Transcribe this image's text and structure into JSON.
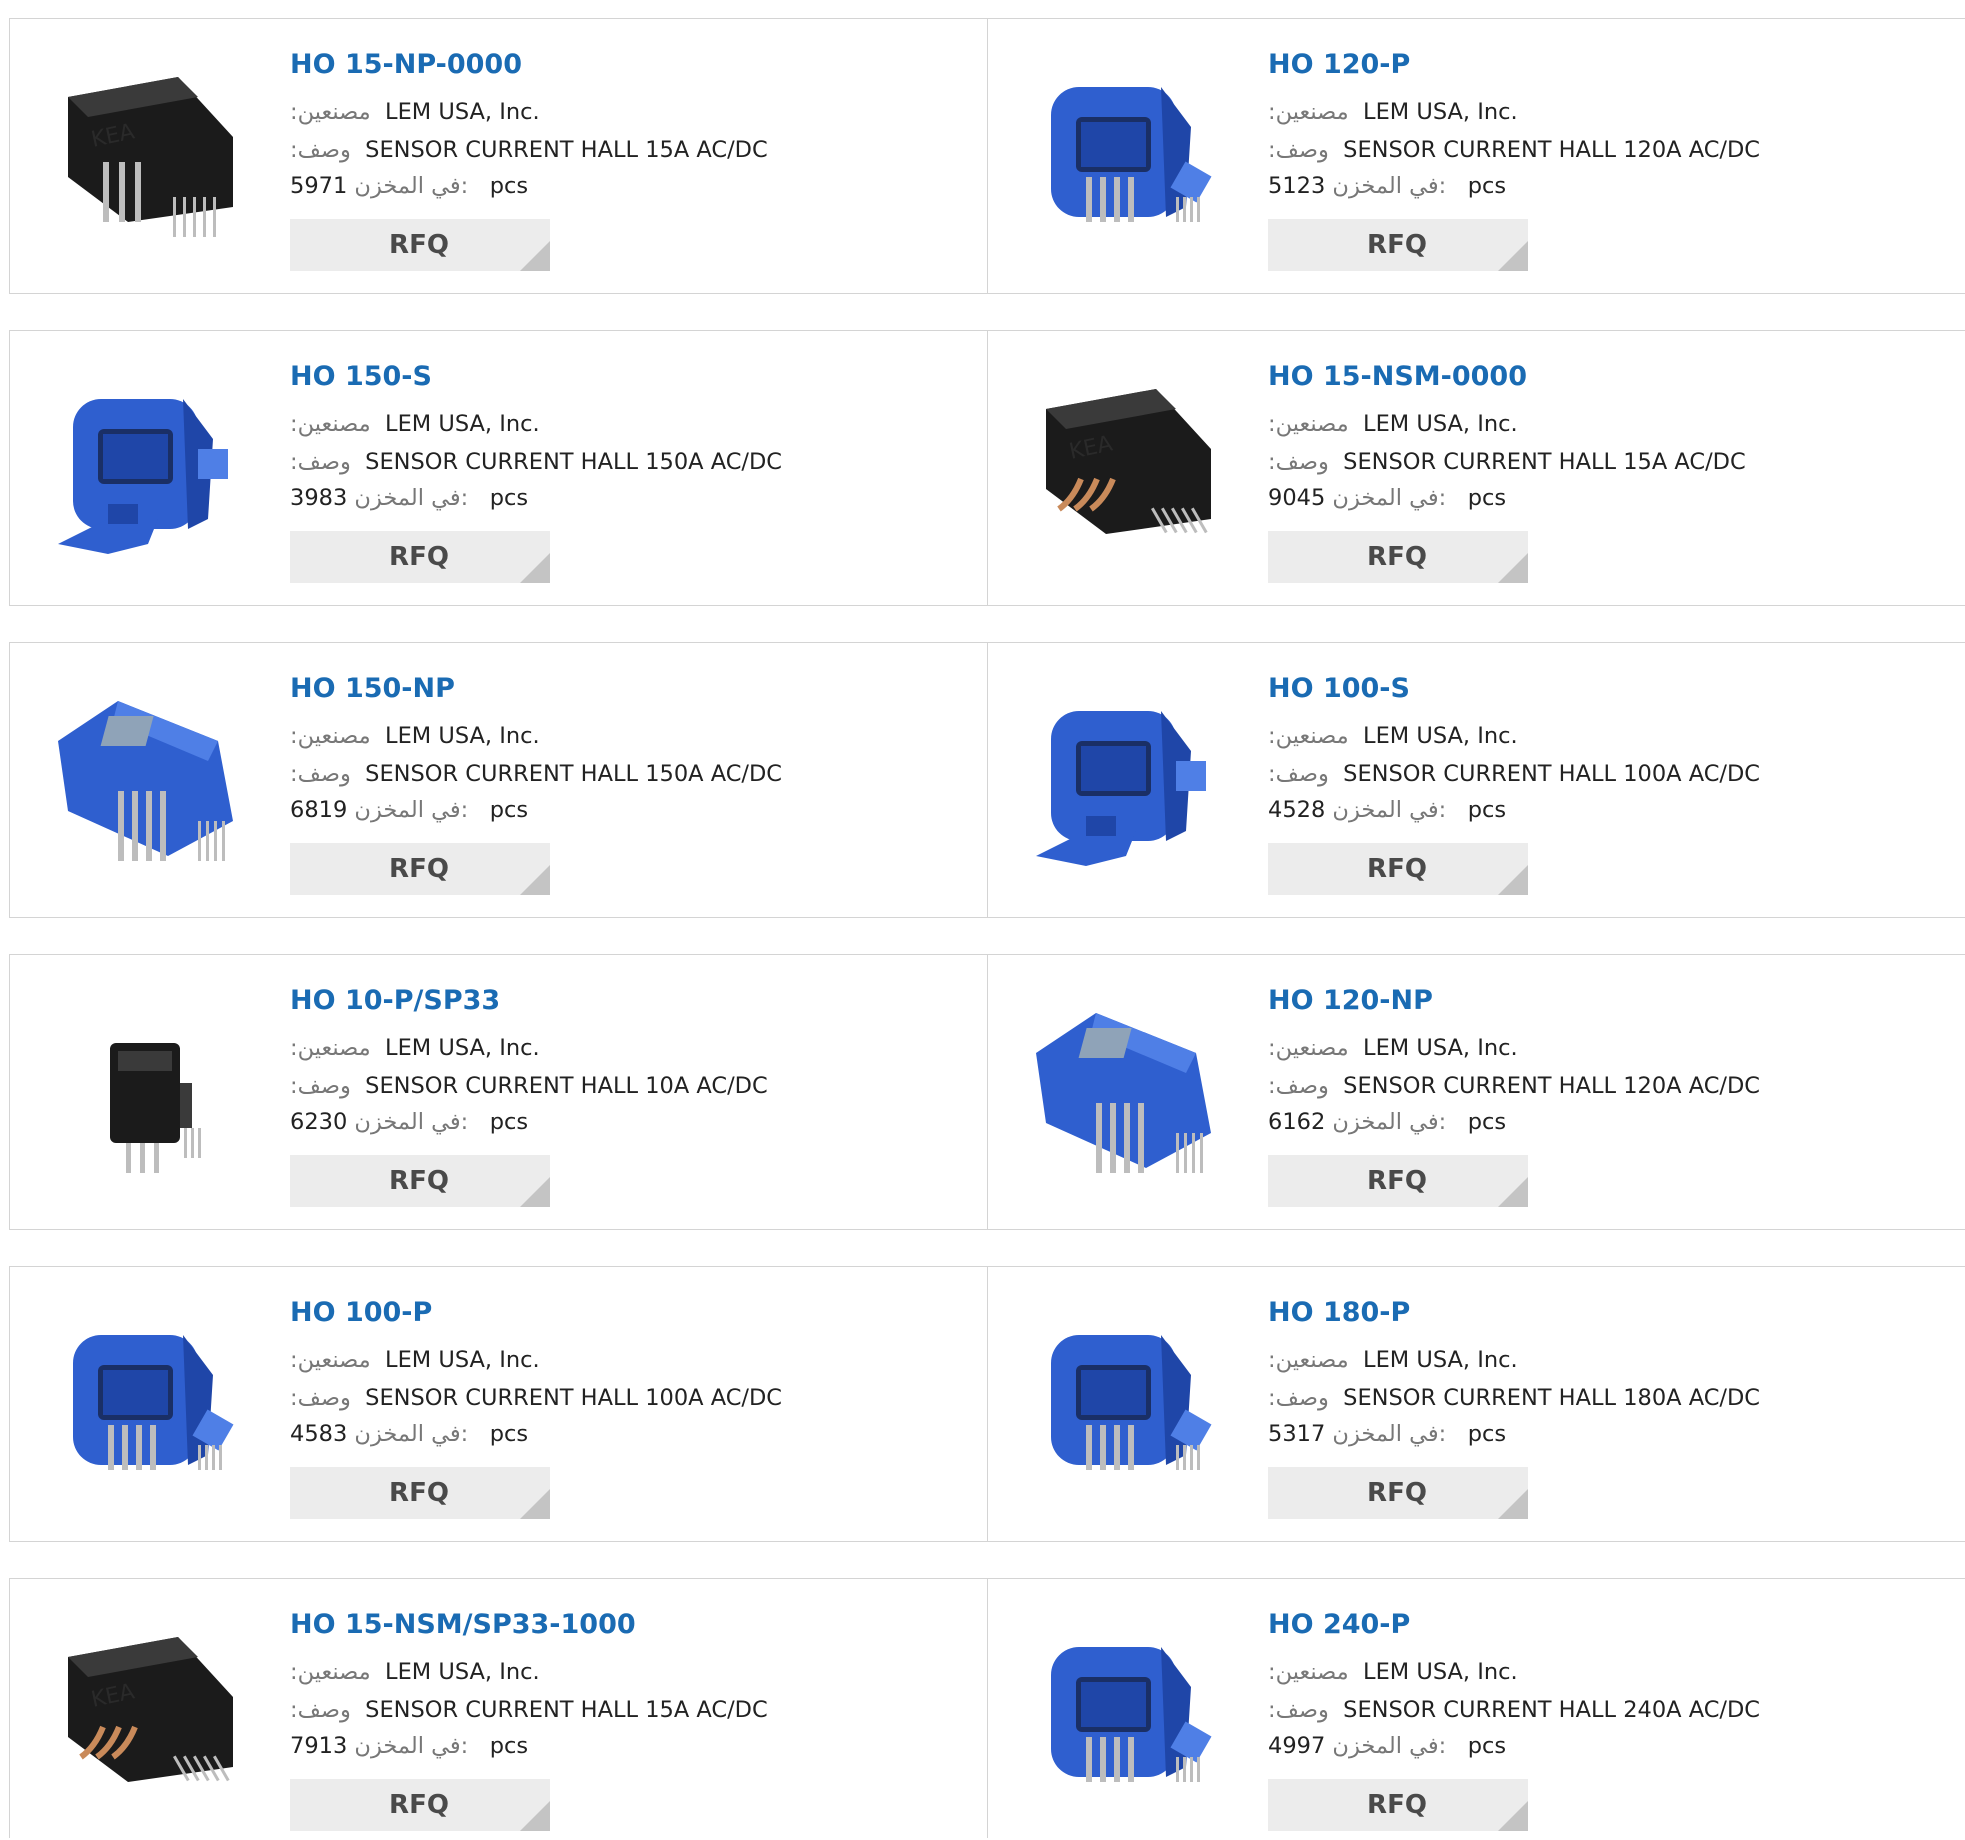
{
  "labels": {
    "manufacturer": ":مصنعين",
    "description": ":وصف",
    "stock": "في المخزن:",
    "unit": "pcs",
    "rfq": "RFQ"
  },
  "products": [
    {
      "part": "HO 15-NP-0000",
      "manufacturer": "LEM USA, Inc.",
      "description": "SENSOR CURRENT HALL 15A AC/DC",
      "stock": "5971",
      "image": "black-sensor-icon"
    },
    {
      "part": "HO 120-P",
      "manufacturer": "LEM USA, Inc.",
      "description": "SENSOR CURRENT HALL 120A AC/DC",
      "stock": "5123",
      "image": "blue-sensor-icon"
    },
    {
      "part": "HO 150-S",
      "manufacturer": "LEM USA, Inc.",
      "description": "SENSOR CURRENT HALL 150A AC/DC",
      "stock": "3983",
      "image": "blue-sensor-clip-icon"
    },
    {
      "part": "HO 15-NSM-0000",
      "manufacturer": "LEM USA, Inc.",
      "description": "SENSOR CURRENT HALL 15A AC/DC",
      "stock": "9045",
      "image": "black-sensor-smd-icon"
    },
    {
      "part": "HO 150-NP",
      "manufacturer": "LEM USA, Inc.",
      "description": "SENSOR CURRENT HALL 150A AC/DC",
      "stock": "6819",
      "image": "blue-sensor-np-icon"
    },
    {
      "part": "HO 100-S",
      "manufacturer": "LEM USA, Inc.",
      "description": "SENSOR CURRENT HALL 100A AC/DC",
      "stock": "4528",
      "image": "blue-sensor-clip-icon"
    },
    {
      "part": "HO 10-P/SP33",
      "manufacturer": "LEM USA, Inc.",
      "description": "SENSOR CURRENT HALL 10A AC/DC",
      "stock": "6230",
      "image": "black-sensor-small-icon"
    },
    {
      "part": "HO 120-NP",
      "manufacturer": "LEM USA, Inc.",
      "description": "SENSOR CURRENT HALL 120A AC/DC",
      "stock": "6162",
      "image": "blue-sensor-np-icon"
    },
    {
      "part": "HO 100-P",
      "manufacturer": "LEM USA, Inc.",
      "description": "SENSOR CURRENT HALL 100A AC/DC",
      "stock": "4583",
      "image": "blue-sensor-icon"
    },
    {
      "part": "HO 180-P",
      "manufacturer": "LEM USA, Inc.",
      "description": "SENSOR CURRENT HALL 180A AC/DC",
      "stock": "5317",
      "image": "blue-sensor-icon"
    },
    {
      "part": "HO 15-NSM/SP33-1000",
      "manufacturer": "LEM USA, Inc.",
      "description": "SENSOR CURRENT HALL 15A AC/DC",
      "stock": "7913",
      "image": "black-sensor-smd-icon"
    },
    {
      "part": "HO 240-P",
      "manufacturer": "LEM USA, Inc.",
      "description": "SENSOR CURRENT HALL 240A AC/DC",
      "stock": "4997",
      "image": "blue-sensor-icon"
    }
  ]
}
